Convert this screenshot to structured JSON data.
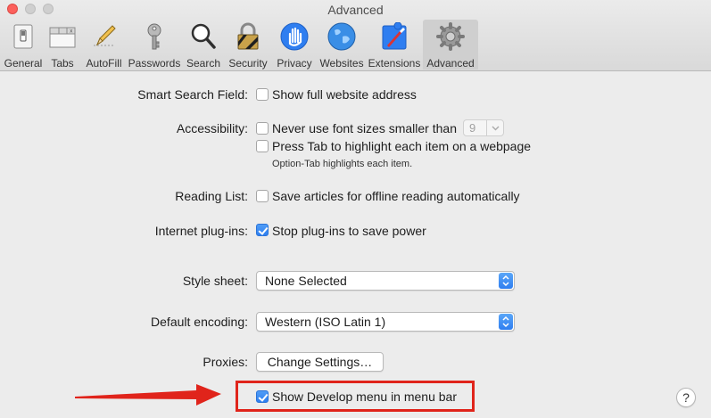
{
  "window": {
    "title": "Advanced"
  },
  "toolbar": {
    "tabs": [
      {
        "label": "General",
        "icon": "general-switch-icon"
      },
      {
        "label": "Tabs",
        "icon": "tabs-icon"
      },
      {
        "label": "AutoFill",
        "icon": "autofill-pencil-icon"
      },
      {
        "label": "Passwords",
        "icon": "key-icon"
      },
      {
        "label": "Search",
        "icon": "magnifier-icon"
      },
      {
        "label": "Security",
        "icon": "padlock-icon"
      },
      {
        "label": "Privacy",
        "icon": "hand-icon"
      },
      {
        "label": "Websites",
        "icon": "globe-icon"
      },
      {
        "label": "Extensions",
        "icon": "puzzle-icon"
      },
      {
        "label": "Advanced",
        "icon": "gear-icon",
        "active": true
      }
    ]
  },
  "settings": {
    "smart_search": {
      "label": "Smart Search Field:",
      "option": "Show full website address",
      "checked": false
    },
    "accessibility": {
      "label": "Accessibility:",
      "font_option": "Never use font sizes smaller than",
      "font_size": "9",
      "font_checked": false,
      "tab_option": "Press Tab to highlight each item on a webpage",
      "tab_checked": false,
      "tab_hint": "Option-Tab highlights each item."
    },
    "reading_list": {
      "label": "Reading List:",
      "option": "Save articles for offline reading automatically",
      "checked": false
    },
    "plugins": {
      "label": "Internet plug-ins:",
      "option": "Stop plug-ins to save power",
      "checked": true
    },
    "style_sheet": {
      "label": "Style sheet:",
      "value": "None Selected"
    },
    "encoding": {
      "label": "Default encoding:",
      "value": "Western (ISO Latin 1)"
    },
    "proxies": {
      "label": "Proxies:",
      "button": "Change Settings…"
    },
    "develop_menu": {
      "option": "Show Develop menu in menu bar",
      "checked": true
    }
  },
  "help": {
    "label": "?"
  },
  "colors": {
    "accent": "#2e7ff0",
    "annotation": "#e0241b"
  }
}
